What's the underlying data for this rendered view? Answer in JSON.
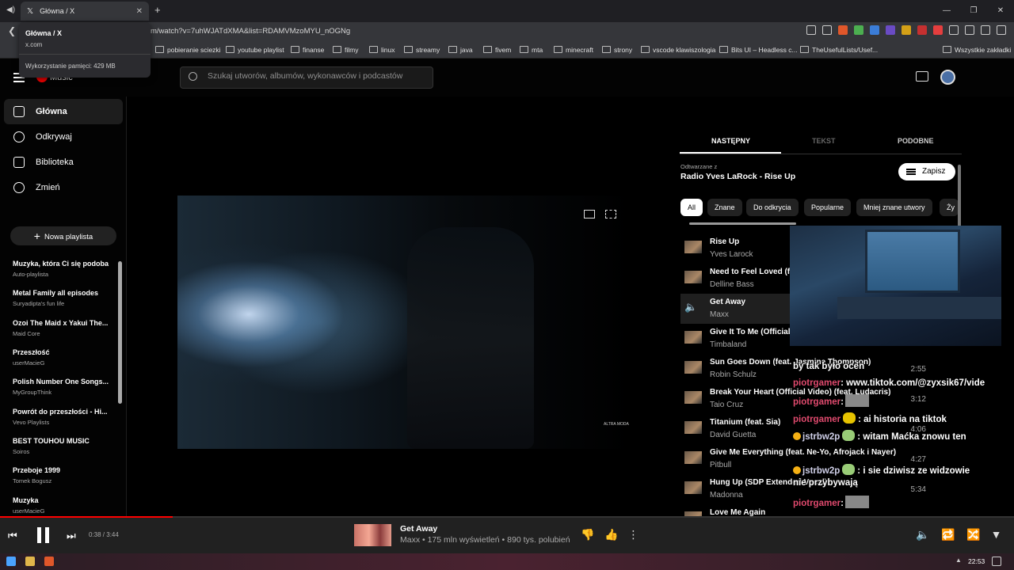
{
  "browser": {
    "tab_title": "Główna / X",
    "tab_close": "✕",
    "new_tab": "+",
    "url": "m/watch?v=7uhWJATdXMA&list=RDAMVMzoMYU_nOGNg",
    "hovercard": {
      "title": "Główna / X",
      "domain": "x.com",
      "memory": "Wykorzystanie pamięci: 429 MB"
    },
    "bookmarks": [
      "pobieranie sciezki",
      "youtube playlist",
      "finanse",
      "filmy",
      "linux",
      "streamy",
      "java",
      "fivem",
      "mta",
      "minecraft",
      "strony",
      "vscode klawiszologia",
      "Bits UI – Headless c...",
      "TheUsefulLists/Usef...",
      "Wszystkie zakładki"
    ],
    "window_controls": [
      "—",
      "❐",
      "✕"
    ]
  },
  "header": {
    "logo_text": "Music",
    "search_placeholder": "Szukaj utworów, albumów, wykonawców i podcastów"
  },
  "sidebar": {
    "nav": [
      {
        "label": "Główna",
        "icon": "home-icon"
      },
      {
        "label": "Odkrywaj",
        "icon": "compass-icon"
      },
      {
        "label": "Biblioteka",
        "icon": "library-icon"
      },
      {
        "label": "Zmień",
        "icon": "upgrade-icon"
      }
    ],
    "new_playlist": "Nowa playlista",
    "playlists": [
      {
        "name": "Muzyka, która Ci się podoba",
        "sub": "Auto-playlista"
      },
      {
        "name": "Metal Family all episodes",
        "sub": "Suryadipta's fun life"
      },
      {
        "name": "Ozoi The Maid x Yakui The...",
        "sub": "Maid Core"
      },
      {
        "name": "Przeszłość",
        "sub": "userMacieG"
      },
      {
        "name": "Polish Number One Songs...",
        "sub": "MyGroupThink"
      },
      {
        "name": "Powrót do przeszłości - Hi...",
        "sub": "Vevo Playlists"
      },
      {
        "name": "BEST TOUHOU MUSIC",
        "sub": "Soiros"
      },
      {
        "name": "Przeboje 1999",
        "sub": "Tomek Bogusz"
      },
      {
        "name": "Muzyka",
        "sub": "userMacieG"
      }
    ]
  },
  "video": {
    "watermark": "ALTRA MODA"
  },
  "queue": {
    "tabs": [
      "NASTĘPNY",
      "TEKST",
      "PODOBNE"
    ],
    "playing_from_label": "Odtwarzane z",
    "playing_from": "Radio Yves LaRock - Rise Up",
    "save_label": "Zapisz",
    "chips": [
      "All",
      "Znane",
      "Do odkrycia",
      "Popularne",
      "Mniej znane utwory",
      "Ży"
    ],
    "items": [
      {
        "title": "Rise Up",
        "artist": "Yves Larock",
        "duration": ""
      },
      {
        "title": "Need to Feel Loved (f",
        "artist": "Delline Bass",
        "duration": ""
      },
      {
        "title": "Get Away",
        "artist": "Maxx",
        "duration": ""
      },
      {
        "title": "Give It To Me (Official",
        "artist": "Timbaland",
        "duration": ""
      },
      {
        "title": "Sun Goes Down (feat. Jasmine Thompson)",
        "artist": "Robin Schulz",
        "duration": "2:55"
      },
      {
        "title": "Break Your Heart (Official Video) (feat. Ludacris)",
        "artist": "Taio Cruz",
        "duration": "3:12"
      },
      {
        "title": "Titanium (feat. Sia)",
        "artist": "David Guetta",
        "duration": "4:06"
      },
      {
        "title": "Give Me Everything (feat. Ne-Yo, Afrojack i Nayer)",
        "artist": "Pitbull",
        "duration": "4:27"
      },
      {
        "title": "Hung Up (SDP Extended Vocal)",
        "artist": "Madonna",
        "duration": "5:34"
      },
      {
        "title": "Love Me Again",
        "artist": "",
        "duration": ""
      }
    ]
  },
  "chat": [
    {
      "user": "",
      "text": "by tak było ocen"
    },
    {
      "user": "piotrgamer",
      "text": ": www.tiktok.com/@zyxsik67/vide"
    },
    {
      "user": "piotrgamer",
      "text": ":"
    },
    {
      "user": "piotrgamer",
      "text": ": ai historia na tiktok"
    },
    {
      "user": "jstrbw2p",
      "text": ": witam Maćka znowu ten"
    },
    {
      "user": "",
      "text": ""
    },
    {
      "user": "jstrbw2p",
      "text": ": i sie dziwisz ze widzowie"
    },
    {
      "user": "",
      "text": "nie przybywają"
    },
    {
      "user": "piotrgamer",
      "text": ":"
    }
  ],
  "player": {
    "time": "0:38 / 3:44",
    "progress": 0.17,
    "title": "Get Away",
    "info": "Maxx • 175 mln wyświetleń • 890 tys. polubień"
  },
  "taskbar": {
    "clock": "22:53"
  }
}
